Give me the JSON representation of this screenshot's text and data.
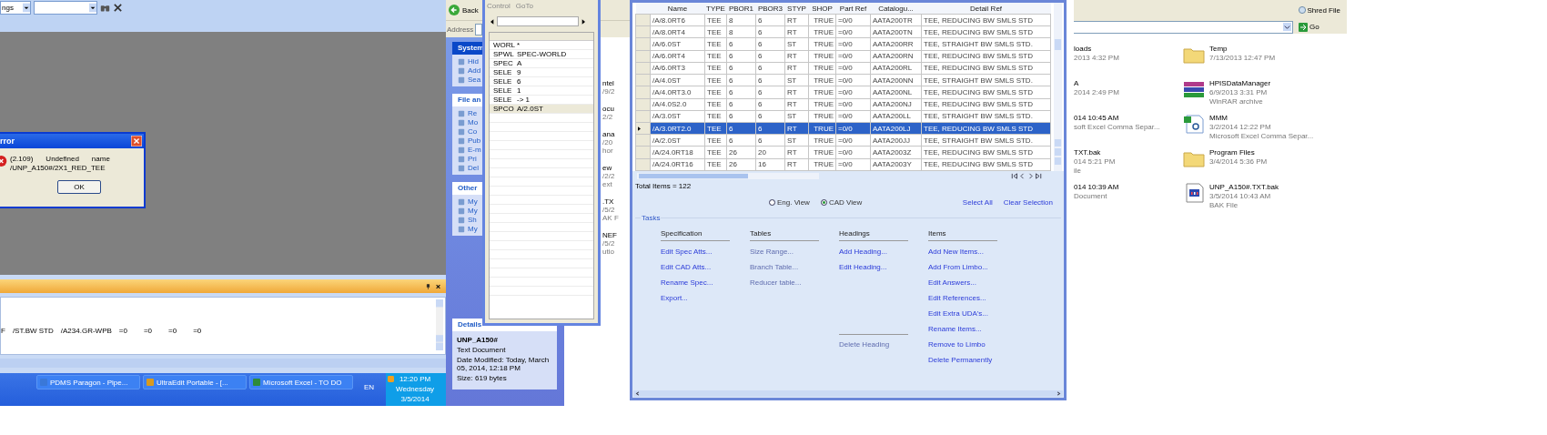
{
  "pdms": {
    "toolbar": {
      "combo": "ngs"
    },
    "error_dialog": {
      "title": "rror",
      "lines": [
        [
          "(2.109)",
          "Undefined",
          "name"
        ],
        [
          "/UNP_A150#/2X1_RED_TEE"
        ]
      ],
      "button": "OK"
    },
    "output_line": [
      "F",
      "/ST.BW STD",
      "/A234.GR-WPB",
      "=0",
      "=0",
      "=0",
      "=0"
    ]
  },
  "taskbar": {
    "buttons": [
      {
        "label": "PDMS Paragon - Pipe...",
        "color": "#3a78d8"
      },
      {
        "label": "UltraEdit Portable - [...",
        "color": "#d89a20"
      },
      {
        "label": "Microsoft Excel - TO DO",
        "color": "#2e8b3a"
      }
    ],
    "language": "EN",
    "clock": [
      "12:20 PM",
      "Wednesday",
      "3/5/2014"
    ]
  },
  "explorer": {
    "back": "Back",
    "address": "Address",
    "panels": [
      {
        "title": "System",
        "items": [
          "Hid",
          "Add",
          "Sea"
        ]
      },
      {
        "title": "File an",
        "items": [
          "Re",
          "Mo",
          "Co",
          "Pub",
          "E-m",
          "Pri",
          "Del"
        ]
      },
      {
        "title": "Other",
        "items": [
          "My",
          "My",
          "Sh",
          "My"
        ]
      }
    ],
    "details": {
      "title": "Details",
      "name": "UNP_A150#",
      "type": "Text Document",
      "modified": "Date Modified: Today, March 05, 2014, 12:18 PM",
      "size": "Size: 619 bytes"
    },
    "fragments": [
      [
        "ntel",
        "/9/2"
      ],
      [
        "ocu",
        "2/2"
      ],
      [
        "ana",
        "/20",
        "hor"
      ],
      [
        "ew",
        "/2/2",
        "ext"
      ],
      [
        ".TX",
        "/5/2",
        "AK F"
      ],
      [
        "NEF",
        "/5/2",
        "utio"
      ]
    ]
  },
  "control_window": {
    "tabs": [
      "Control",
      "GoTo"
    ],
    "rows": [
      {
        "code": "WORL",
        "value": "*",
        "selected": false
      },
      {
        "code": "SPWL",
        "value": "SPEC-WORLD",
        "selected": false
      },
      {
        "code": "SPEC",
        "value": "A",
        "selected": false
      },
      {
        "code": "SELE",
        "value": "9",
        "selected": false
      },
      {
        "code": "SELE",
        "value": "6",
        "selected": false
      },
      {
        "code": "SELE",
        "value": "1",
        "selected": false
      },
      {
        "code": "SELE",
        "value": "-> 1",
        "selected": false
      },
      {
        "code": "SPCO",
        "value": "A/2.0ST",
        "selected": true
      }
    ]
  },
  "spec_window": {
    "columns": [
      "Name",
      "TYPE",
      "PBOR1",
      "PBOR3",
      "STYP",
      "SHOP",
      "Part Ref",
      "Catalogu...",
      "Detail Ref"
    ],
    "rows": [
      {
        "cells": [
          "/A/8.0RT6",
          "TEE",
          "8",
          "6",
          "RT",
          "TRUE",
          "=0/0",
          "AATA200TR",
          "TEE, REDUCING BW SMLS STD"
        ],
        "selected": false
      },
      {
        "cells": [
          "/A/8.0RT4",
          "TEE",
          "8",
          "6",
          "RT",
          "TRUE",
          "=0/0",
          "AATA200TN",
          "TEE, REDUCING BW SMLS STD"
        ],
        "selected": false
      },
      {
        "cells": [
          "/A/6.0ST",
          "TEE",
          "6",
          "6",
          "ST",
          "TRUE",
          "=0/0",
          "AATA200RR",
          "TEE, STRAIGHT BW SMLS STD."
        ],
        "selected": false
      },
      {
        "cells": [
          "/A/6.0RT4",
          "TEE",
          "6",
          "6",
          "RT",
          "TRUE",
          "=0/0",
          "AATA200RN",
          "TEE, REDUCING BW SMLS STD"
        ],
        "selected": false
      },
      {
        "cells": [
          "/A/6.0RT3",
          "TEE",
          "6",
          "6",
          "RT",
          "TRUE",
          "=0/0",
          "AATA200RL",
          "TEE, REDUCING BW SMLS STD"
        ],
        "selected": false
      },
      {
        "cells": [
          "/A/4.0ST",
          "TEE",
          "6",
          "6",
          "ST",
          "TRUE",
          "=0/0",
          "AATA200NN",
          "TEE, STRAIGHT BW SMLS STD."
        ],
        "selected": false
      },
      {
        "cells": [
          "/A/4.0RT3.0",
          "TEE",
          "6",
          "6",
          "RT",
          "TRUE",
          "=0/0",
          "AATA200NL",
          "TEE, REDUCING BW SMLS STD"
        ],
        "selected": false
      },
      {
        "cells": [
          "/A/4.0S2.0",
          "TEE",
          "6",
          "6",
          "RT",
          "TRUE",
          "=0/0",
          "AATA200NJ",
          "TEE, REDUCING BW SMLS STD"
        ],
        "selected": false
      },
      {
        "cells": [
          "/A/3.0ST",
          "TEE",
          "6",
          "6",
          "ST",
          "TRUE",
          "=0/0",
          "AATA200LL",
          "TEE, STRAIGHT BW SMLS STD."
        ],
        "selected": false
      },
      {
        "cells": [
          "/A/3.0RT2.0",
          "TEE",
          "6",
          "6",
          "RT",
          "TRUE",
          "=0/0",
          "AATA200LJ",
          "TEE, REDUCING BW SMLS STD"
        ],
        "selected": true
      },
      {
        "cells": [
          "/A/2.0ST",
          "TEE",
          "6",
          "6",
          "ST",
          "TRUE",
          "=0/0",
          "AATA200JJ",
          "TEE, STRAIGHT BW SMLS STD."
        ],
        "selected": false
      },
      {
        "cells": [
          "/A/24.0RT18",
          "TEE",
          "26",
          "20",
          "RT",
          "TRUE",
          "=0/0",
          "AATA2003Z",
          "TEE, REDUCING BW SMLS STD"
        ],
        "selected": false
      },
      {
        "cells": [
          "/A/24.0RT16",
          "TEE",
          "26",
          "16",
          "RT",
          "TRUE",
          "=0/0",
          "AATA2003Y",
          "TEE, REDUCING BW SMLS STD"
        ],
        "selected": false
      }
    ],
    "total": "Total Items = 122",
    "views": [
      {
        "label": "Eng. View",
        "selected": false
      },
      {
        "label": "CAD View",
        "selected": true
      }
    ],
    "links": [
      "Select All",
      "Clear Selection"
    ],
    "tasks_title": "Tasks",
    "groups": [
      {
        "heading": "Specification",
        "items": [
          {
            "label": "Edit Spec Atts...",
            "disabled": false,
            "kind": "link"
          },
          {
            "label": "Edit CAD Atts...",
            "disabled": false,
            "kind": "link"
          },
          {
            "label": "Rename Spec...",
            "disabled": false,
            "kind": "link"
          },
          {
            "label": "Export...",
            "disabled": false,
            "kind": "link"
          }
        ]
      },
      {
        "heading": "Tables",
        "items": [
          {
            "label": "Size Range...",
            "disabled": true,
            "kind": "link"
          },
          {
            "label": "Branch Table...",
            "disabled": true,
            "kind": "link"
          },
          {
            "label": "Reducer table...",
            "disabled": true,
            "kind": "link"
          }
        ]
      },
      {
        "heading": "Headings",
        "items": [
          {
            "label": "Add Heading...",
            "disabled": false,
            "kind": "link"
          },
          {
            "label": "Edit Heading...",
            "disabled": false,
            "kind": "link"
          },
          {
            "label": "Delete Heading",
            "disabled": true,
            "kind": "separated"
          }
        ]
      },
      {
        "heading": "Items",
        "items": [
          {
            "label": "Add New Items...",
            "disabled": false,
            "kind": "link"
          },
          {
            "label": "Add From Limbo...",
            "disabled": false,
            "kind": "link"
          },
          {
            "label": "Edit Answers...",
            "disabled": false,
            "kind": "link"
          },
          {
            "label": "Edit References...",
            "disabled": false,
            "kind": "link"
          },
          {
            "label": "Edit Extra UDA's...",
            "disabled": false,
            "kind": "link"
          },
          {
            "label": "Rename Items...",
            "disabled": false,
            "kind": "link"
          },
          {
            "label": "Remove to Limbo",
            "disabled": false,
            "kind": "link"
          },
          {
            "label": "Delete Permanently",
            "disabled": false,
            "kind": "link"
          }
        ]
      }
    ]
  },
  "right_explorer": {
    "shred": "Shred File",
    "go": "Go",
    "fragments": [
      [
        "loads",
        "2013 4:32 PM"
      ],
      [
        "A",
        "2014 2:49 PM"
      ],
      [
        "014 10:45 AM",
        "soft Excel Comma Separ..."
      ],
      [
        "TXT.bak",
        "014 5:21 PM",
        "ile"
      ],
      [
        "014 10:39 AM",
        "Document"
      ]
    ],
    "files": [
      {
        "name": "Temp",
        "lines": [
          "7/13/2013 12:47 PM"
        ],
        "kind": "folder"
      },
      {
        "name": "HPISDataManager",
        "lines": [
          "6/9/2013 3:31 PM",
          "WinRAR archive"
        ],
        "kind": "archive"
      },
      {
        "name": "MMM",
        "lines": [
          "3/2/2014 12:22 PM",
          "Microsoft Excel Comma Separ..."
        ],
        "kind": "csv"
      },
      {
        "name": "Program Files",
        "lines": [
          "3/4/2014 5:36 PM"
        ],
        "kind": "folder"
      },
      {
        "name": "UNP_A150#.TXT.bak",
        "lines": [
          "3/5/2014 10:43 AM",
          "BAK File"
        ],
        "kind": "bak"
      }
    ]
  }
}
